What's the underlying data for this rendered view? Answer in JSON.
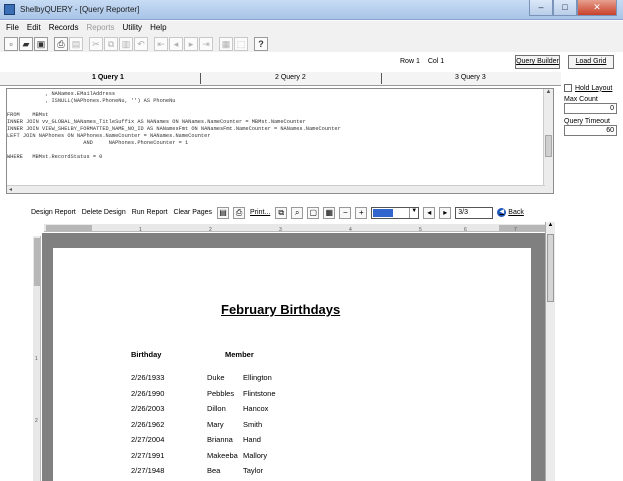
{
  "window": {
    "title": "ShelbyQUERY - [Query Reporter]"
  },
  "menu": [
    "File",
    "Edit",
    "Records",
    "Reports",
    "Utility",
    "Help"
  ],
  "menu_disabled": [
    "Reports"
  ],
  "status": {
    "row": "Row 1",
    "col": "Col 1"
  },
  "buttons": {
    "query_builder": "Query Builder",
    "load_grid": "Load Grid"
  },
  "tabs": [
    "1 Query 1",
    "2 Query 2",
    "3 Query 3"
  ],
  "sql_lines": [
    "            , NANames.EMailAddress",
    "            , ISNULL(NAPhones.PhoneNu, '') AS PhoneNu",
    "",
    "FROM    MBMst",
    "INNER JOIN vv_GLOBAL_NANames_TitleSuffix AS NANames ON NANames.NameCounter = MBMst.NameCounter",
    "INNER JOIN VIEW_SHELBY_FORMATTED_NAME_NO_ID AS NANamesFmt ON NANamesFmt.NameCounter = NANames.NameCounter",
    "LEFT JOIN NAPhones ON NAPhones.NameCounter = NANames.NameCounter",
    "                        AND     NAPhones.PhoneCounter = 1",
    "",
    "WHERE   MBMst.RecordStatus = 0"
  ],
  "right_panel": {
    "hold_layout": "Hold Layout",
    "max_count_label": "Max Count",
    "max_count_value": "0",
    "timeout_label": "Query Timeout",
    "timeout_value": "60"
  },
  "report_toolbar": {
    "design_report": "Design Report",
    "delete_design": "Delete Design",
    "run_report": "Run Report",
    "clear_pages": "Clear Pages",
    "print": "Print...",
    "page": "3/3",
    "back": "Back"
  },
  "report": {
    "title": "February Birthdays",
    "col_birthday": "Birthday",
    "col_member": "Member",
    "rows": [
      {
        "date": "2/26/1933",
        "first": "Duke",
        "last": "Ellington"
      },
      {
        "date": "2/26/1990",
        "first": "Pebbles",
        "last": "Flintstone"
      },
      {
        "date": "2/26/2003",
        "first": "Dillon",
        "last": "Hancox"
      },
      {
        "date": "2/26/1962",
        "first": "Mary",
        "last": "Smith"
      },
      {
        "date": "2/27/2004",
        "first": "Brianna",
        "last": "Hand"
      },
      {
        "date": "2/27/1991",
        "first": "Makeeba",
        "last": "Mallory"
      },
      {
        "date": "2/27/1948",
        "first": "Bea",
        "last": "Taylor"
      }
    ]
  },
  "ruler_ticks": [
    "1",
    "2",
    "3",
    "4",
    "5",
    "6",
    "7"
  ],
  "colors": {
    "titlebar": "#a9c4e8",
    "preview_bg": "#808080",
    "accent": "#3366cc"
  }
}
